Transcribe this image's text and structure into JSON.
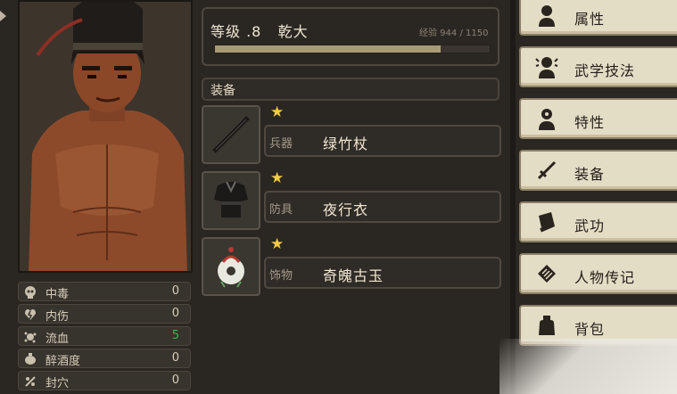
{
  "status": [
    {
      "label": "中毒",
      "value": "0",
      "icon": "skull-icon",
      "color": "#d7cdb9"
    },
    {
      "label": "内伤",
      "value": "0",
      "icon": "broken-heart-icon",
      "color": "#d7cdb9"
    },
    {
      "label": "流血",
      "value": "5",
      "icon": "blood-splash-icon",
      "color": "#3fb34a"
    },
    {
      "label": "醉酒度",
      "value": "0",
      "icon": "wine-jar-icon",
      "color": "#d7cdb9"
    },
    {
      "label": "封穴",
      "value": "0",
      "icon": "acupoint-icon",
      "color": "#d7cdb9"
    }
  ],
  "character": {
    "level_text": "等级 .8   乾大",
    "exp_text": "经验 944 / 1150",
    "exp_current": 944,
    "exp_max": 1150
  },
  "equipment": {
    "title": "装备",
    "items": [
      {
        "type": "兵器",
        "name": "绿竹杖",
        "icon": "bamboo-staff-icon",
        "stars": "★"
      },
      {
        "type": "防具",
        "name": "夜行衣",
        "icon": "night-clothes-icon",
        "stars": "★"
      },
      {
        "type": "饰物",
        "name": "奇魄古玉",
        "icon": "jade-pendant-icon",
        "stars": "★"
      }
    ]
  },
  "menu": [
    {
      "label": "属性",
      "icon": "person-icon"
    },
    {
      "label": "武学技法",
      "icon": "martial-person-icon"
    },
    {
      "label": "特性",
      "icon": "trait-person-icon"
    },
    {
      "label": "装备",
      "icon": "sword-icon"
    },
    {
      "label": "武功",
      "icon": "book-icon"
    },
    {
      "label": "人物传记",
      "icon": "scroll-icon"
    },
    {
      "label": "背包",
      "icon": "bag-icon"
    }
  ],
  "colors": {
    "accent_star": "#f3cc46",
    "menu_bg": "#e4ddc6",
    "panel_bg": "#2a2621",
    "bleed_value": "#3fb34a"
  }
}
